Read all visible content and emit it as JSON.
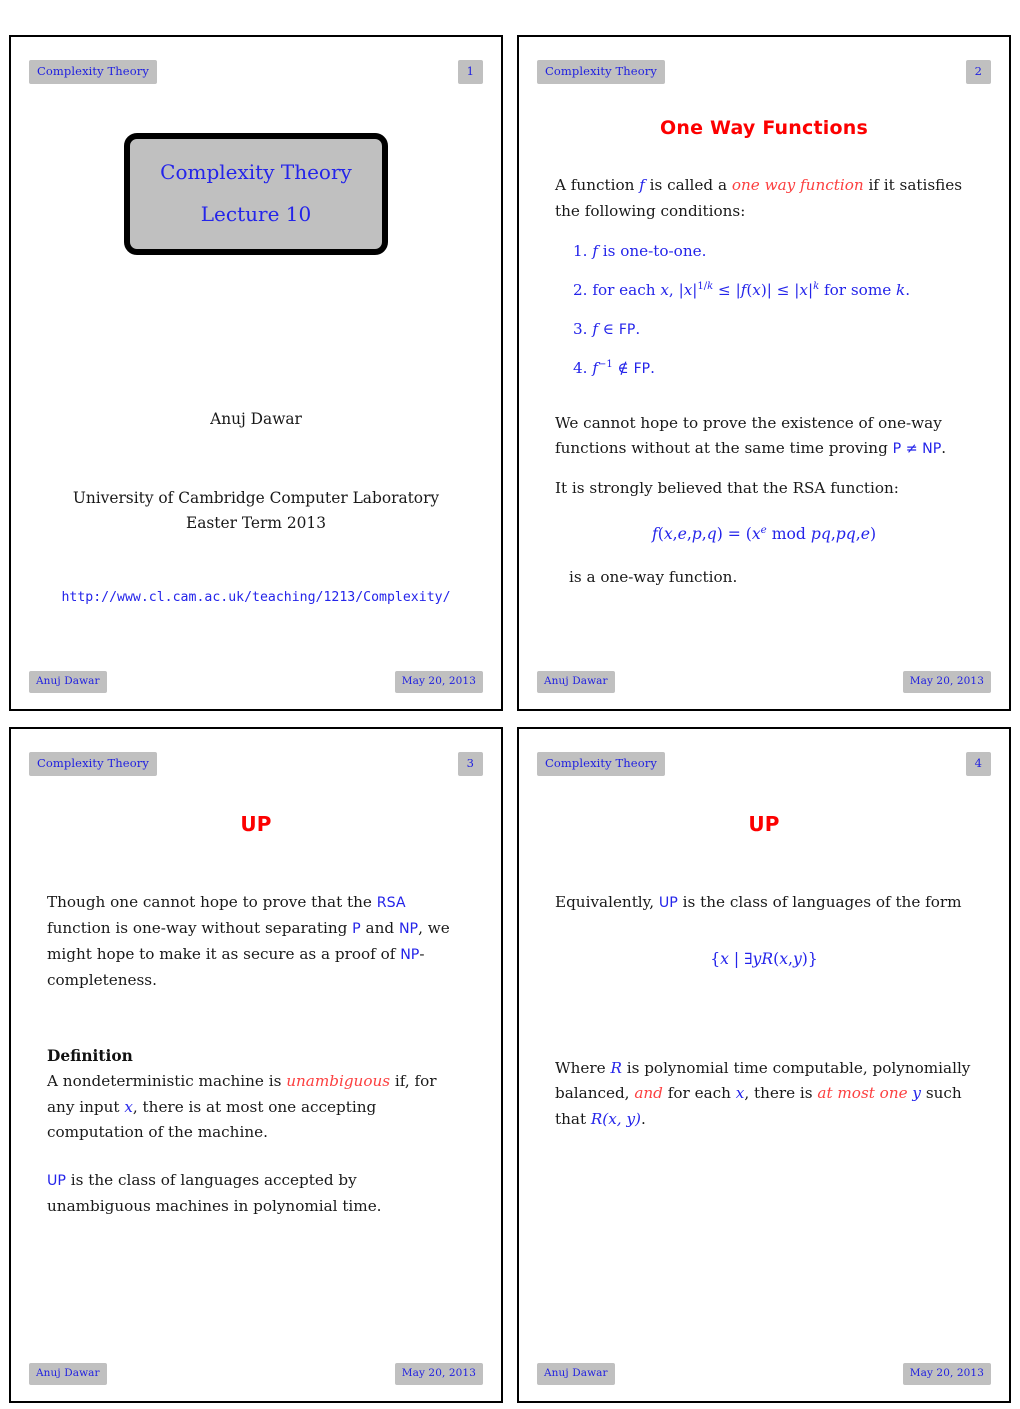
{
  "document": {
    "title": "Complexity Theory — Lecture 10",
    "colors": {
      "badge_bg": "#c0c0c0",
      "badge_text": "#2020e0",
      "accent_red": "#fc0000",
      "accent_blue": "#2424ea",
      "body_text": "#191919"
    }
  },
  "slides": [
    {
      "header": {
        "course": "Complexity Theory",
        "page": "1"
      },
      "footer": {
        "author": "Anuj Dawar",
        "date": "May 20, 2013"
      },
      "title_box": {
        "line1": "Complexity Theory",
        "line2": "Lecture 10"
      },
      "author": "Anuj Dawar",
      "affiliation_line1": "University of Cambridge Computer Laboratory",
      "affiliation_line2": "Easter Term 2013",
      "url": "http://www.cl.cam.ac.uk/teaching/1213/Complexity/"
    },
    {
      "header": {
        "course": "Complexity Theory",
        "page": "2"
      },
      "footer": {
        "author": "Anuj Dawar",
        "date": "May 20, 2013"
      },
      "title": "One Way Functions",
      "intro_a": "A function ",
      "intro_f": "f",
      "intro_b": " is called a ",
      "intro_term": "one way function",
      "intro_c": " if it satisfies the following conditions:",
      "items": [
        {
          "n": "1.",
          "text_a": "f",
          "text_b": " is one-to-one."
        },
        {
          "n": "2.",
          "text_a": "for each x,",
          "text_b": "|x|^{1/k} ≤ |f(x)| ≤ |x|^k for some k."
        },
        {
          "n": "3.",
          "text_a": "f",
          "text_b": " ∈ FP."
        },
        {
          "n": "4.",
          "text_a": "f^{-1}",
          "text_b": " ∉ FP."
        }
      ],
      "para2_a": "We cannot hope to prove the existence of one-way functions without at the same time proving ",
      "para2_pnp": "P ≠ NP",
      "para2_b": ".",
      "para3": "It is strongly believed that the RSA function:",
      "equation": "f(x, e, p, q) = (xᵉ mod pq, pq, e)",
      "para4": "is a one-way function."
    },
    {
      "header": {
        "course": "Complexity Theory",
        "page": "3"
      },
      "footer": {
        "author": "Anuj Dawar",
        "date": "May 20, 2013"
      },
      "title": "UP",
      "para1_a": "Though one cannot hope to prove that the ",
      "para1_rsa": "RSA",
      "para1_b": " function is one-way without separating ",
      "para1_p": "P",
      "para1_c": " and ",
      "para1_np": "NP",
      "para1_d": ", we might hope to make it as secure as a proof of ",
      "para1_np2": "NP",
      "para1_e": "-completeness.",
      "definition_heading": "Definition",
      "def_a": "A nondeterministic machine is ",
      "def_term": "unambiguous",
      "def_b": " if, for any input ",
      "def_x": "x",
      "def_c": ", there is at most one accepting computation of the machine.",
      "para2_up": "UP",
      "para2_text": " is the class of languages accepted by unambiguous machines in polynomial time."
    },
    {
      "header": {
        "course": "Complexity Theory",
        "page": "4"
      },
      "footer": {
        "author": "Anuj Dawar",
        "date": "May 20, 2013"
      },
      "title": "UP",
      "para1_a": "Equivalently, ",
      "para1_up": "UP",
      "para1_b": " is the class of languages of the form",
      "equation": "{x | ∃yR(x, y)}",
      "para2_a": "Where ",
      "para2_R": "R",
      "para2_b": " is polynomial time computable, polynomially balanced, ",
      "para2_and": "and",
      "para2_c": " for each ",
      "para2_x": "x",
      "para2_d": ", there is ",
      "para2_atmostone": "at most one",
      "para2_e": " ",
      "para2_y": "y",
      "para2_f": " such that ",
      "para2_Rxy": "R(x, y)",
      "para2_g": "."
    }
  ]
}
